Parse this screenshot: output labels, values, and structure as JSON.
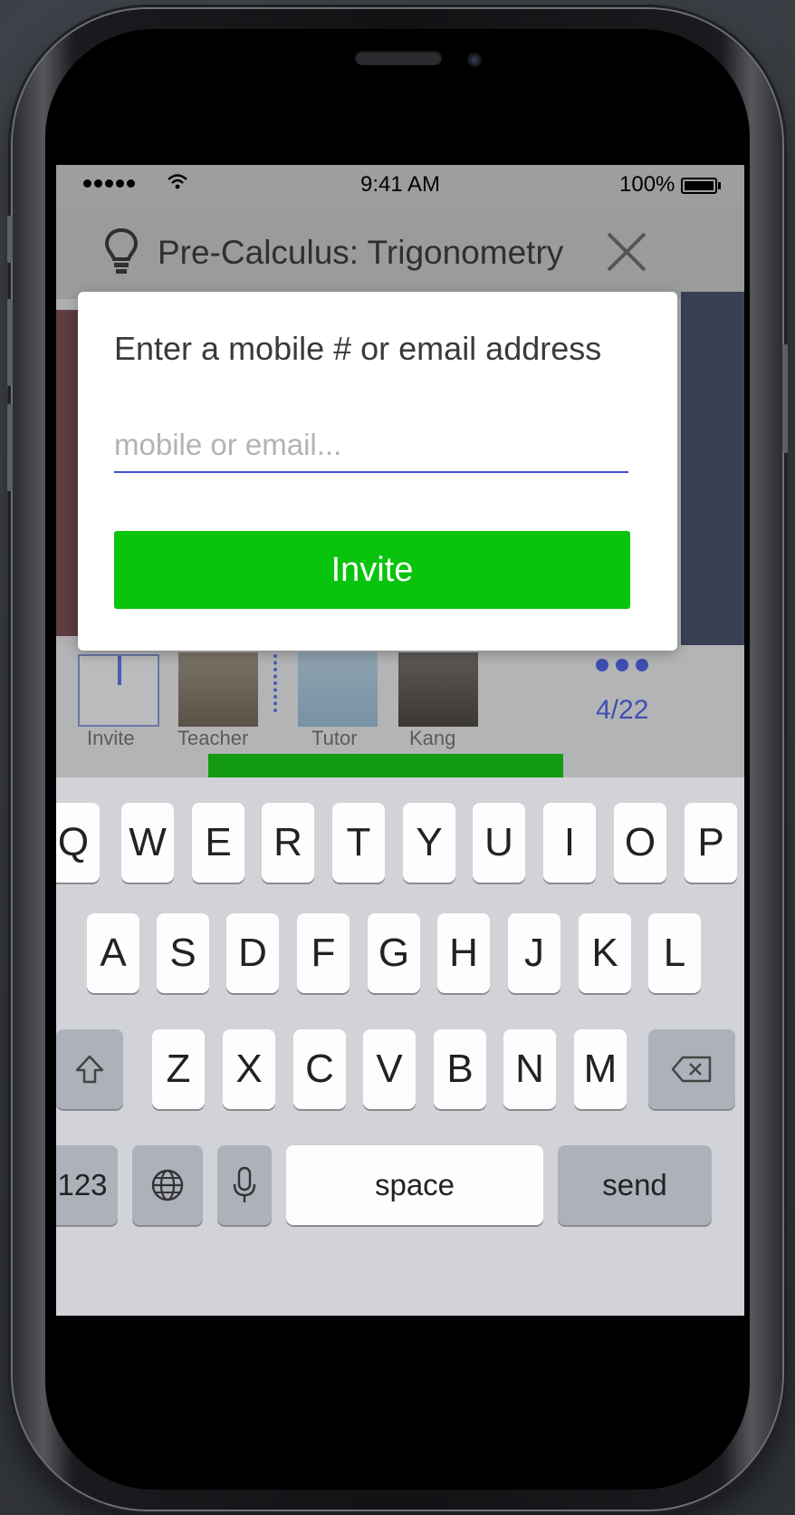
{
  "status_bar": {
    "time": "9:41 AM",
    "battery": "100%"
  },
  "nav": {
    "title": "Pre-Calculus: Trigonometry",
    "left_icon": "lightbulb-icon",
    "right_icon": "close-icon"
  },
  "dialog": {
    "title": "Enter a mobile # or email address",
    "input_placeholder": "mobile or email...",
    "input_value": "",
    "invite_label": "Invite"
  },
  "participants": {
    "invite_label": "Invite",
    "members": [
      "Teacher",
      "Tutor",
      "Kang"
    ],
    "page_count": "4/22"
  },
  "keyboard": {
    "row1": [
      "Q",
      "W",
      "E",
      "R",
      "T",
      "Y",
      "U",
      "I",
      "O",
      "P"
    ],
    "row2": [
      "A",
      "S",
      "D",
      "F",
      "G",
      "H",
      "J",
      "K",
      "L"
    ],
    "row3": [
      "Z",
      "X",
      "C",
      "V",
      "B",
      "N",
      "M"
    ],
    "numbers_label": "123",
    "space_label": "space",
    "send_label": "send"
  },
  "colors": {
    "accent_blue": "#3d4fd0",
    "invite_green": "#09c40c"
  }
}
